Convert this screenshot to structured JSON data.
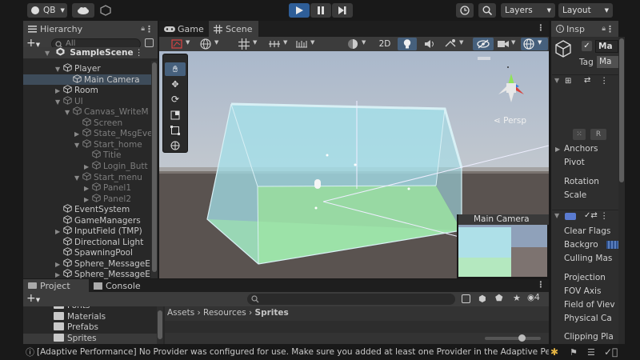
{
  "toolbar": {
    "account_label": "QB",
    "layers_label": "Layers",
    "layout_label": "Layout"
  },
  "hierarchy": {
    "tab_label": "Hierarchy",
    "search_placeholder": "All",
    "scene_name": "SampleScene",
    "items": [
      {
        "label": "Player",
        "depth": 1,
        "arrow": "down",
        "dim": false
      },
      {
        "label": "Main Camera",
        "depth": 2,
        "arrow": "none",
        "dim": false,
        "selected": true
      },
      {
        "label": "Room",
        "depth": 1,
        "arrow": "right",
        "dim": false
      },
      {
        "label": "UI",
        "depth": 1,
        "arrow": "down",
        "dim": true
      },
      {
        "label": "Canvas_WriteM",
        "depth": 2,
        "arrow": "down",
        "dim": true
      },
      {
        "label": "Screen",
        "depth": 3,
        "arrow": "none",
        "dim": true
      },
      {
        "label": "State_MsgEve",
        "depth": 3,
        "arrow": "right",
        "dim": true
      },
      {
        "label": "Start_home",
        "depth": 3,
        "arrow": "down",
        "dim": true
      },
      {
        "label": "Title",
        "depth": 4,
        "arrow": "none",
        "dim": true
      },
      {
        "label": "Login_Butt",
        "depth": 4,
        "arrow": "right",
        "dim": true
      },
      {
        "label": "Start_menu",
        "depth": 3,
        "arrow": "down",
        "dim": true
      },
      {
        "label": "Panel1",
        "depth": 4,
        "arrow": "right",
        "dim": true
      },
      {
        "label": "Panel2",
        "depth": 4,
        "arrow": "right",
        "dim": true
      },
      {
        "label": "EventSystem",
        "depth": 1,
        "arrow": "none",
        "dim": false
      },
      {
        "label": "GameManagers",
        "depth": 1,
        "arrow": "none",
        "dim": false
      },
      {
        "label": "InputField (TMP)",
        "depth": 1,
        "arrow": "right",
        "dim": false
      },
      {
        "label": "Directional Light",
        "depth": 1,
        "arrow": "none",
        "dim": false
      },
      {
        "label": "SpawningPool",
        "depth": 1,
        "arrow": "none",
        "dim": false
      },
      {
        "label": "Sphere_MessageE",
        "depth": 1,
        "arrow": "right",
        "dim": false
      },
      {
        "label": "Sphere_MessageE",
        "depth": 1,
        "arrow": "right",
        "dim": false
      }
    ]
  },
  "scene": {
    "tab_game": "Game",
    "tab_scene": "Scene",
    "mode_2d": "2D",
    "persp_label": "Persp",
    "camera_preview_title": "Main Camera"
  },
  "project": {
    "tab_project": "Project",
    "tab_console": "Console",
    "folders": [
      "Fonts",
      "Materials",
      "Prefabs",
      "Sprites"
    ],
    "breadcrumb": [
      "Assets",
      "Resources",
      "Sprites"
    ],
    "hidden_count": "4"
  },
  "inspector": {
    "tab_label": "Insp",
    "object_name": "Ma",
    "tag_label": "Tag",
    "tag_value": "Ma",
    "transform_labels": [
      "Anchors",
      "Pivot",
      "Rotation",
      "Scale"
    ],
    "camera_labels": [
      "Clear Flags",
      "Backgro",
      "Culling Mas",
      "Projection",
      "FOV Axis",
      "Field of Viev",
      "Physical Ca",
      "Clipping Pla"
    ]
  },
  "status": {
    "message": "[Adaptive Performance] No Provider was configured for use. Make sure you added at least one Provider in the Adaptive Per"
  },
  "colors": {
    "play_button": "#2e5e98",
    "selection": "#2c5d87",
    "room_fill": "#a4e0ea",
    "floor_fill": "#9fe8ac",
    "sky": "#abb9cc",
    "ground": "#5a5350"
  }
}
